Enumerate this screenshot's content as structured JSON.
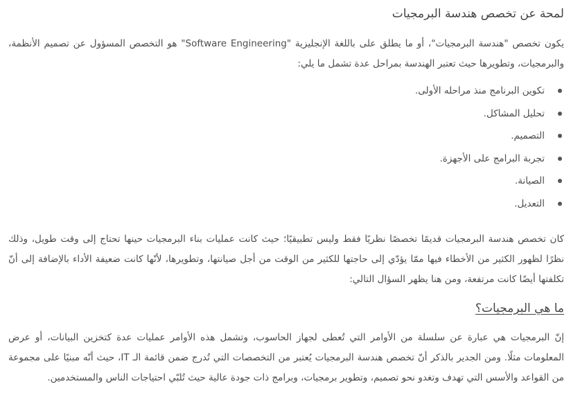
{
  "article": {
    "heading": "لمحة عن تخصص هندسة البرمجيات",
    "intro": "يكون تخصص \"هندسة البرمجيات\"، أو ما يطلق على باللغة الإنجليزية \"Software Engineering\" هو التخصص المسؤول عن تصميم الأنظمة، والبرمجيات، وتطويرها حيث تعتبر الهندسة بمراحل عدة تشمل ما يلي:",
    "stages": [
      "تكوين البرنامج منذ مراحله الأولى.",
      "تحليل المشاكل.",
      "التصميم.",
      "تجربة البرامج على الأجهزة.",
      "الصيانة.",
      "التعديل."
    ],
    "history": "كان تخصص هندسة البرمجيات قديمًا تخصصًا نظريًا فقط وليس تطبيقيًا؛ حيث كانت عمليات بناء البرمجيات حينها تحتاج إلى وقت طويل، وذلك نظرًا لظهور الكثير من الأخطاء فيها ممّا يؤدّي إلى حاجتها للكثير من الوقت من أجل صيانتها، وتطويرها، لأنّها كانت ضعيفة الأداء بالإضافة إلى أنّ تكلفتها أيضًا كانت مرتفعة، ومن هنا يظهر السؤال التالي:",
    "subheading": "ما هي البرمجيات؟",
    "definition": "إنّ البرمجيات هي عبارة عن سلسلة من الأوامر التي تُعطى لجهاز الحاسوب، وتشمل هذه الأوامر عمليات عدة كتخزين البيانات، أو عرض المعلومات مثلًا. ومن الجدير بالذكر أنّ تخصص هندسة البرمجيات يُعتبر من التخصصات التي تُدرج ضمن قائمة الـ IT، حيث أنّه مبنيًا على مجموعة من القواعد والأسس التي تهدف وتغدو نحو تصميم، وتطوير برمجيات، وبرامج ذات جودة عالية حيث تُلبّي احتياجات الناس والمستخدمين."
  }
}
